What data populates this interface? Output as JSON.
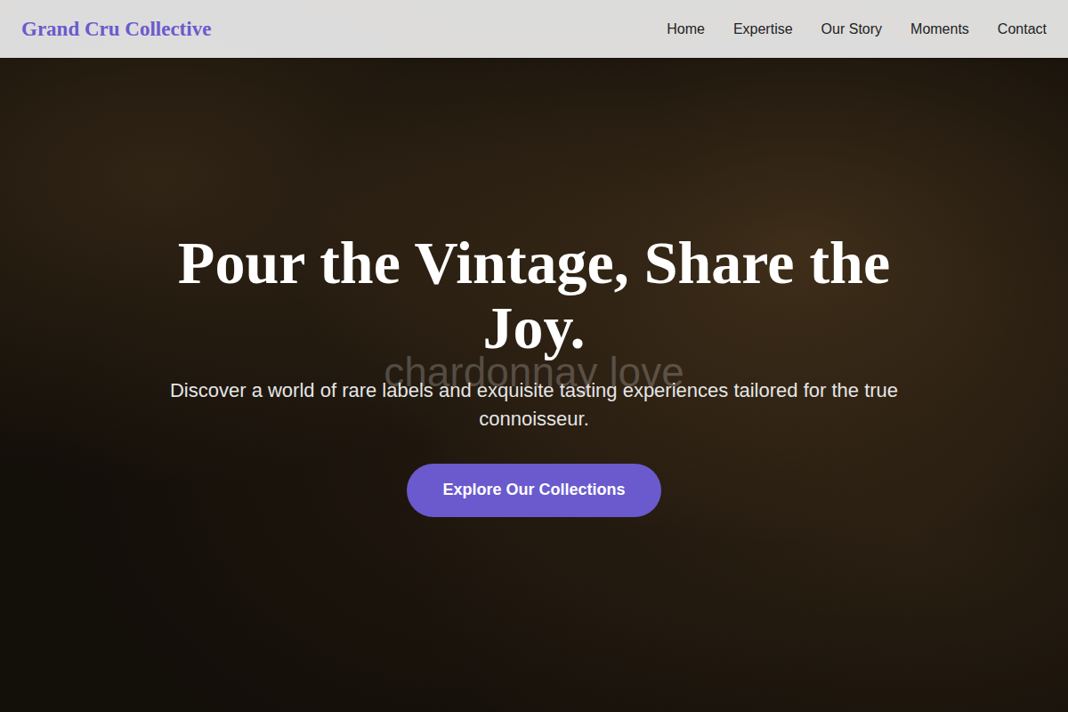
{
  "nav": {
    "logo": "Grand Cru Collective",
    "links": [
      "Home",
      "Expertise",
      "Our Story",
      "Moments",
      "Contact"
    ]
  },
  "hero": {
    "title": "Pour the Vintage, Share the Joy.",
    "watermark": "chardonnay love",
    "subtitle": "Discover a world of rare labels and exquisite tasting experiences tailored for the true connoisseur.",
    "button": "Explore Our Collections"
  }
}
